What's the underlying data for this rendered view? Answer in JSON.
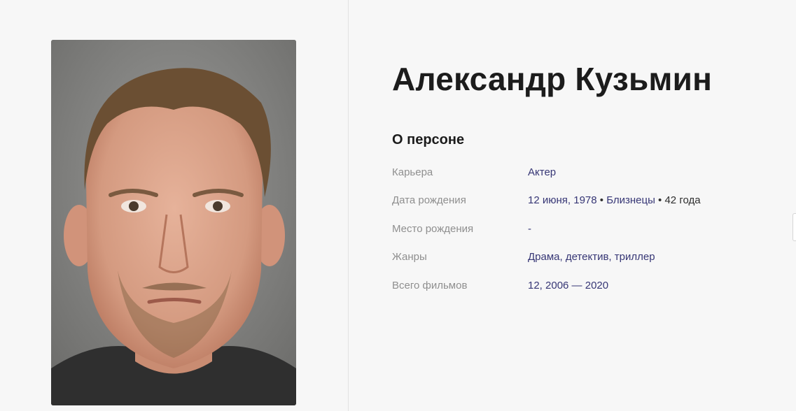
{
  "person": {
    "name": "Александр Кузьмин",
    "photo_icon": "person-portrait"
  },
  "about": {
    "title": "О персоне",
    "rows": [
      {
        "label": "Карьера",
        "value": "Актер"
      },
      {
        "label": "Дата рождения",
        "value_date": "12 июня, 1978",
        "separator1": " • ",
        "value_sign": "Близнецы",
        "separator2": " • ",
        "value_age": "42 года"
      },
      {
        "label": "Место рождения",
        "value": "-"
      },
      {
        "label": "Жанры",
        "value": "Драма, детектив, триллер"
      },
      {
        "label": "Всего фильмов",
        "value": "12, 2006 — 2020"
      }
    ]
  }
}
